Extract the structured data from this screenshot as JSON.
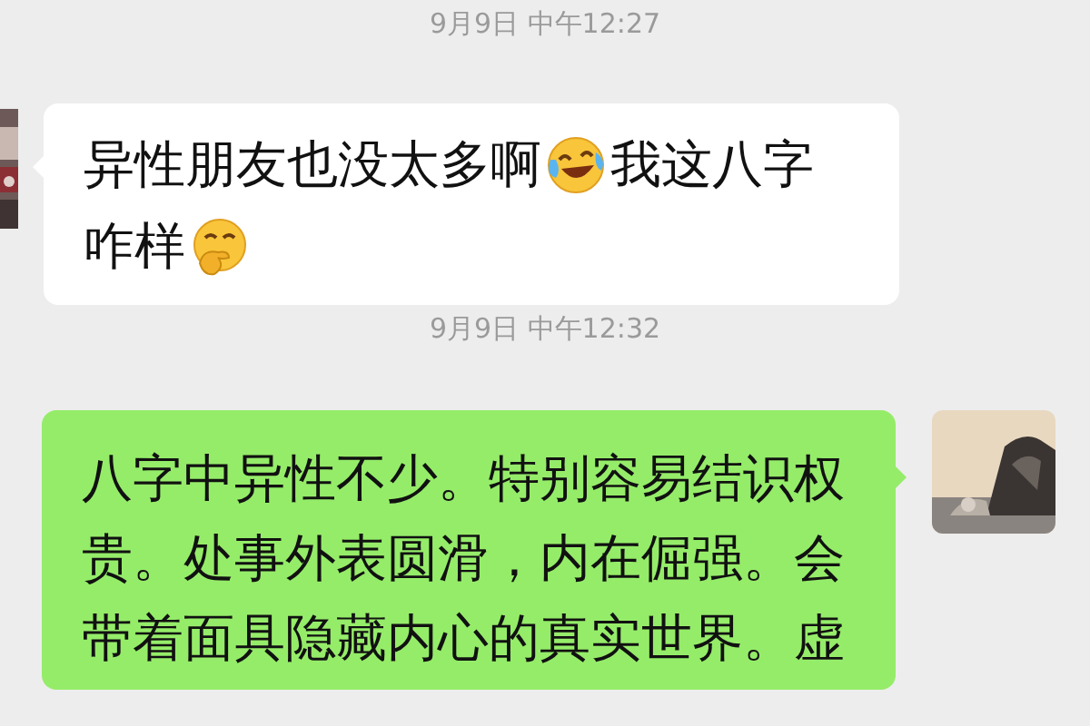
{
  "messages": [
    {
      "kind": "time",
      "text": "9月9日 中午12:27"
    },
    {
      "kind": "incoming",
      "avatar": {
        "kind": "picture"
      },
      "lines": [
        [
          {
            "kind": "text",
            "text": "异性朋友也没太多啊"
          },
          {
            "kind": "laugh"
          },
          {
            "kind": "text",
            "text": "我这八字"
          }
        ],
        [
          {
            "kind": "text",
            "text": "咋样"
          },
          {
            "kind": "think"
          }
        ]
      ]
    },
    {
      "kind": "time",
      "text": "9月9日 中午12:32"
    },
    {
      "kind": "outgoing",
      "avatar": {
        "kind": "picture"
      },
      "lines": [
        "八字中异性不少。特别容易结识权",
        "贵。处事外表圆滑，内在倔强。会",
        "带着面具隐藏内心的真实世界。虚"
      ]
    }
  ]
}
